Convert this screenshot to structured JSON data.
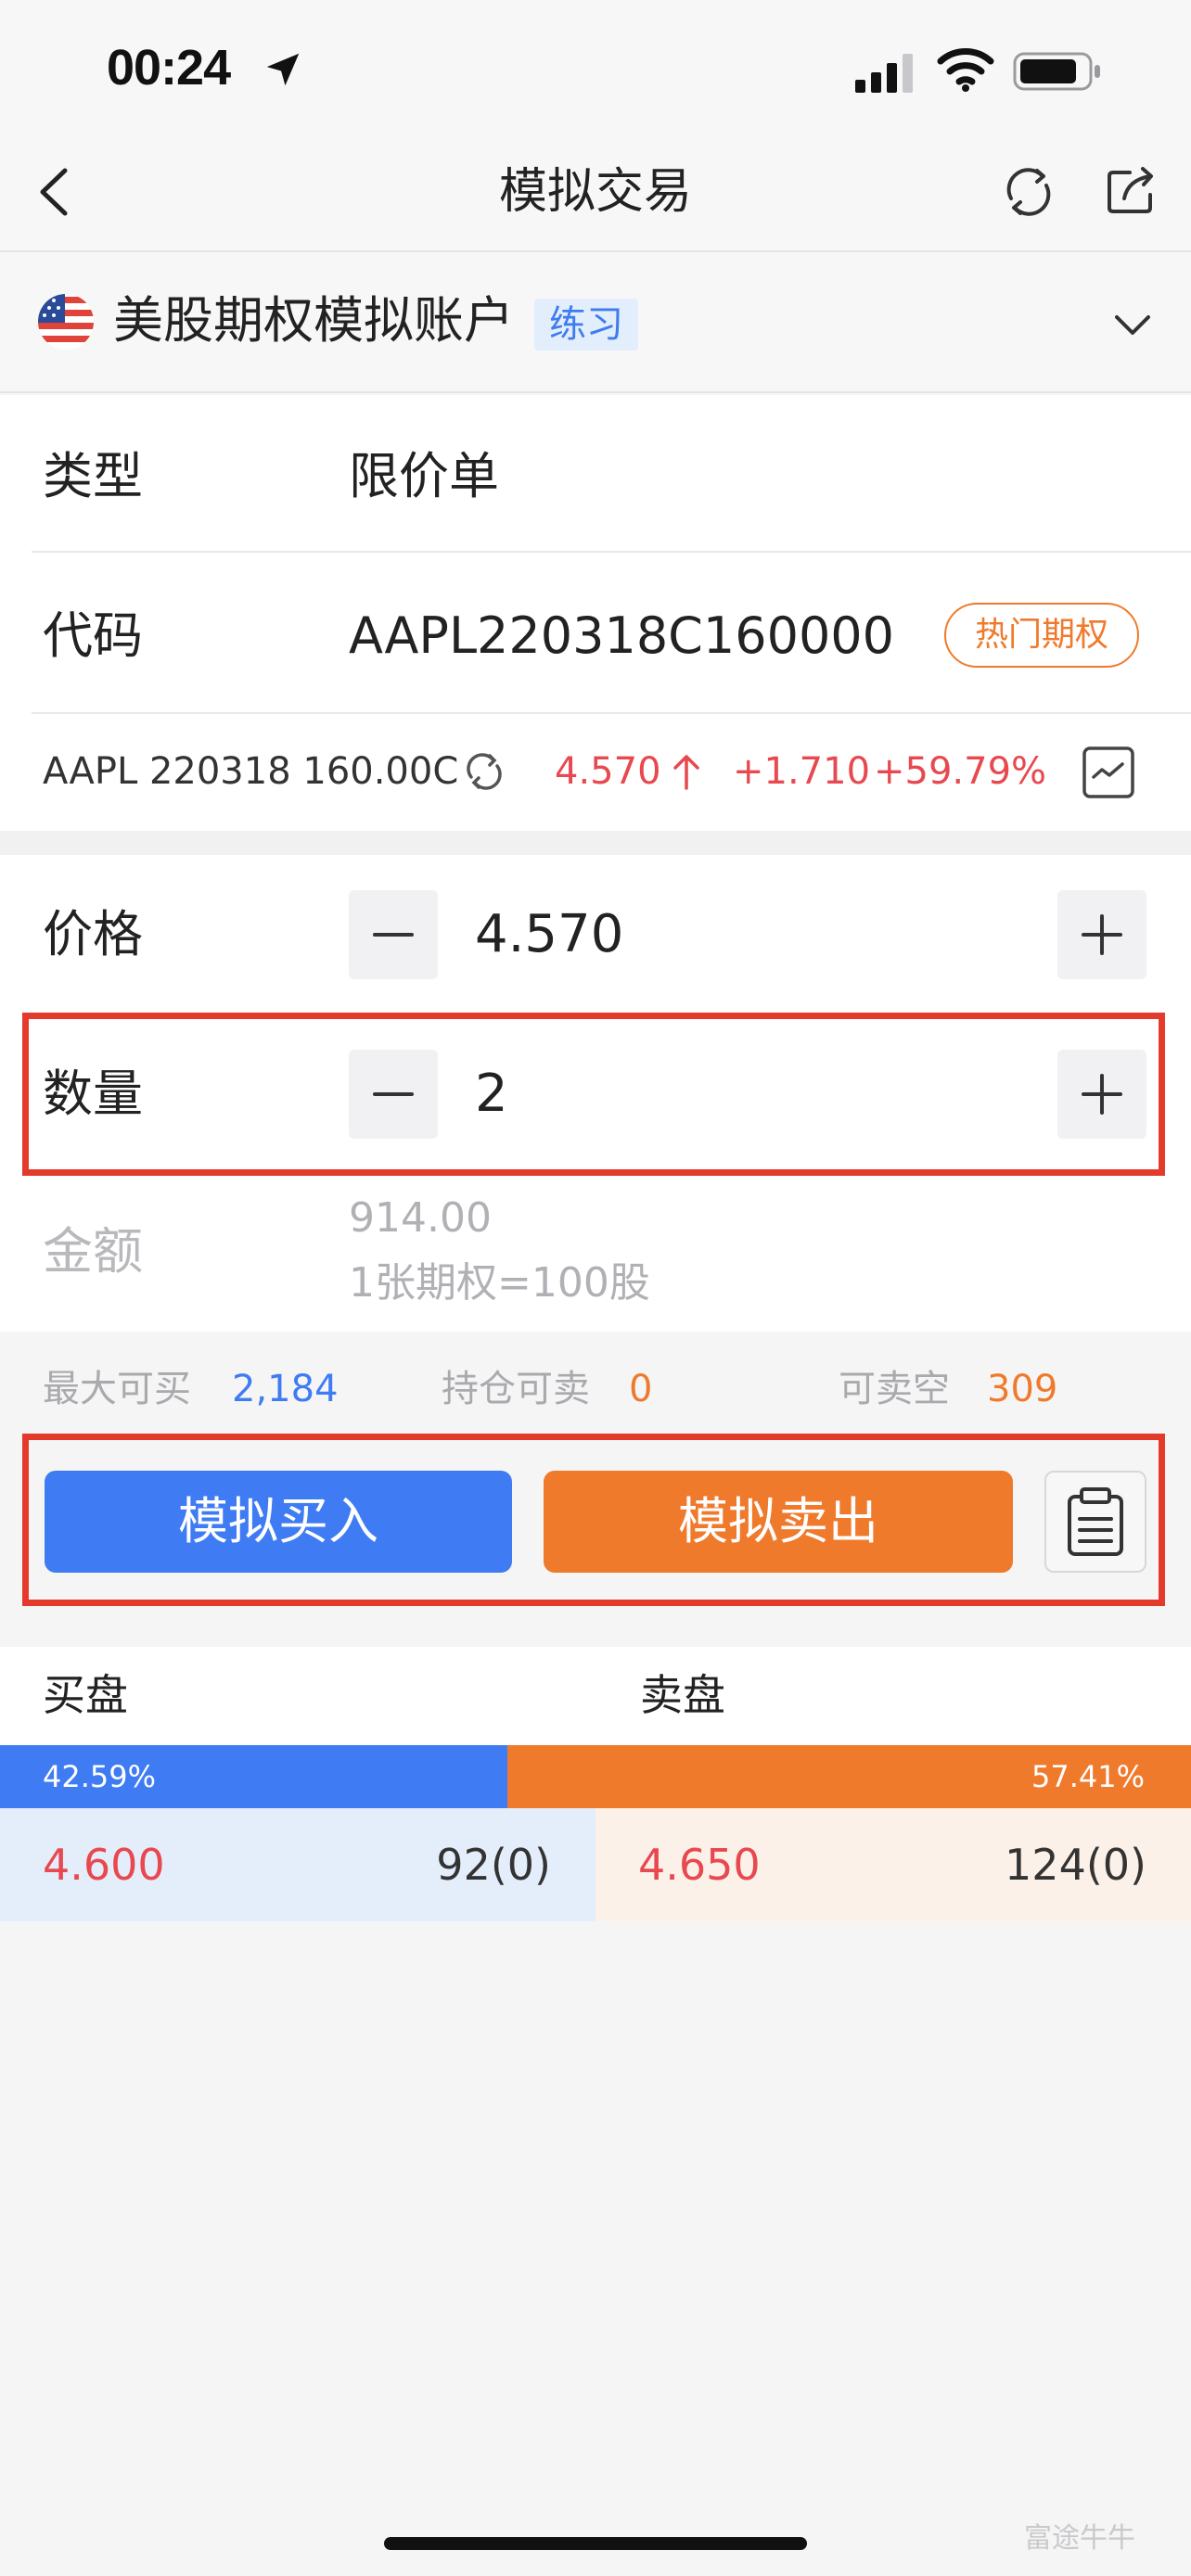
{
  "status_bar": {
    "time": "00:24"
  },
  "nav": {
    "title": "模拟交易"
  },
  "account": {
    "name": "美股期权模拟账户",
    "badge": "练习"
  },
  "form": {
    "type_label": "类型",
    "type_value": "限价单",
    "code_label": "代码",
    "code_value": "AAPL220318C160000",
    "hot_label": "热门期权",
    "price_label": "价格",
    "price_value": "4.570",
    "qty_label": "数量",
    "qty_value": "2",
    "amount_label": "金额",
    "amount_value": "914.00",
    "amount_note": "1张期权=100股"
  },
  "quote": {
    "symbol": "AAPL 220318 160.00C",
    "price": "4.570",
    "change": "+1.710",
    "change_pct": "+59.79%",
    "color_up": "#e8484f"
  },
  "limits": {
    "max_buy_label": "最大可买",
    "max_buy_value": "2,184",
    "hold_sell_label": "持仓可卖",
    "hold_sell_value": "0",
    "short_label": "可卖空",
    "short_value": "309"
  },
  "actions": {
    "buy_label": "模拟买入",
    "sell_label": "模拟卖出"
  },
  "order_book": {
    "bid_header": "买盘",
    "ask_header": "卖盘",
    "bid_pct_label": "42.59%",
    "ask_pct_label": "57.41%",
    "bid_pct": 42.59,
    "ask_pct": 57.41,
    "bid_price": "4.600",
    "bid_volume": "92(0)",
    "ask_price": "4.650",
    "ask_volume": "124(0)"
  },
  "watermark": "富途牛牛",
  "colors": {
    "buy": "#3f7cf3",
    "sell": "#f07a2c",
    "highlight": "#e43a2c",
    "up": "#e8484f"
  }
}
